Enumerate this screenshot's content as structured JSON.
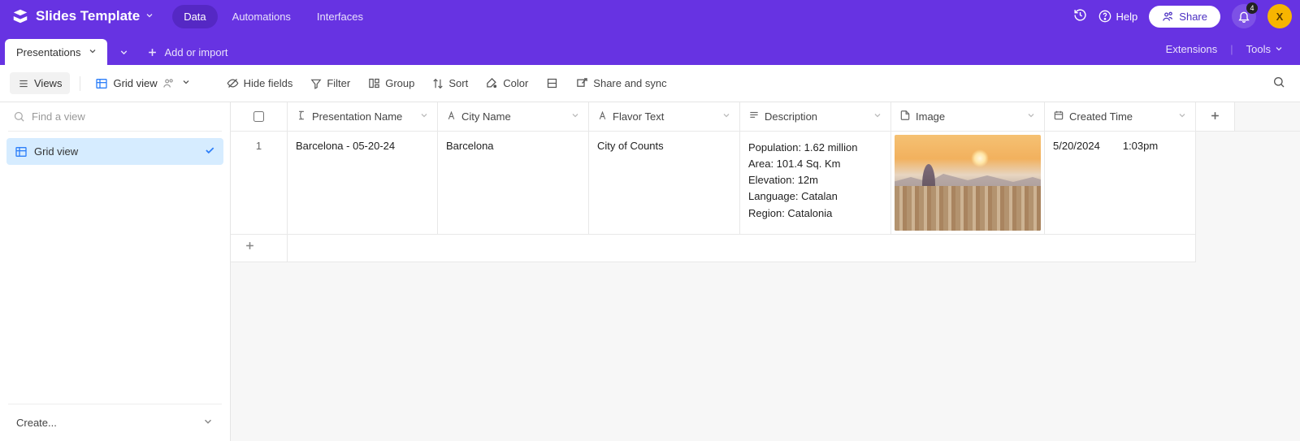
{
  "topbar": {
    "base_name": "Slides Template",
    "nav": {
      "data": "Data",
      "automations": "Automations",
      "interfaces": "Interfaces"
    },
    "help": "Help",
    "share": "Share",
    "notif_count": "4",
    "avatar_initial": "X"
  },
  "tablebar": {
    "active_table": "Presentations",
    "add_or_import": "Add or import",
    "extensions": "Extensions",
    "tools": "Tools"
  },
  "toolbar": {
    "views": "Views",
    "view_name": "Grid view",
    "hide_fields": "Hide fields",
    "filter": "Filter",
    "group": "Group",
    "sort": "Sort",
    "color": "Color",
    "share_sync": "Share and sync"
  },
  "sidebar": {
    "find_placeholder": "Find a view",
    "views": [
      {
        "label": "Grid view"
      }
    ],
    "create": "Create..."
  },
  "grid": {
    "columns": {
      "presentation_name": "Presentation Name",
      "city_name": "City Name",
      "flavor_text": "Flavor Text",
      "description": "Description",
      "image": "Image",
      "created_time": "Created Time"
    },
    "row": {
      "num": "1",
      "presentation_name": "Barcelona - 05-20-24",
      "city_name": "Barcelona",
      "flavor_text": "City of Counts",
      "description": {
        "population": "Population: 1.62 million",
        "area": "Area: 101.4 Sq. Km",
        "elevation": "Elevation: 12m",
        "language": "Language: Catalan",
        "region": "Region: Catalonia"
      },
      "created_date": "5/20/2024",
      "created_time": "1:03pm"
    }
  }
}
